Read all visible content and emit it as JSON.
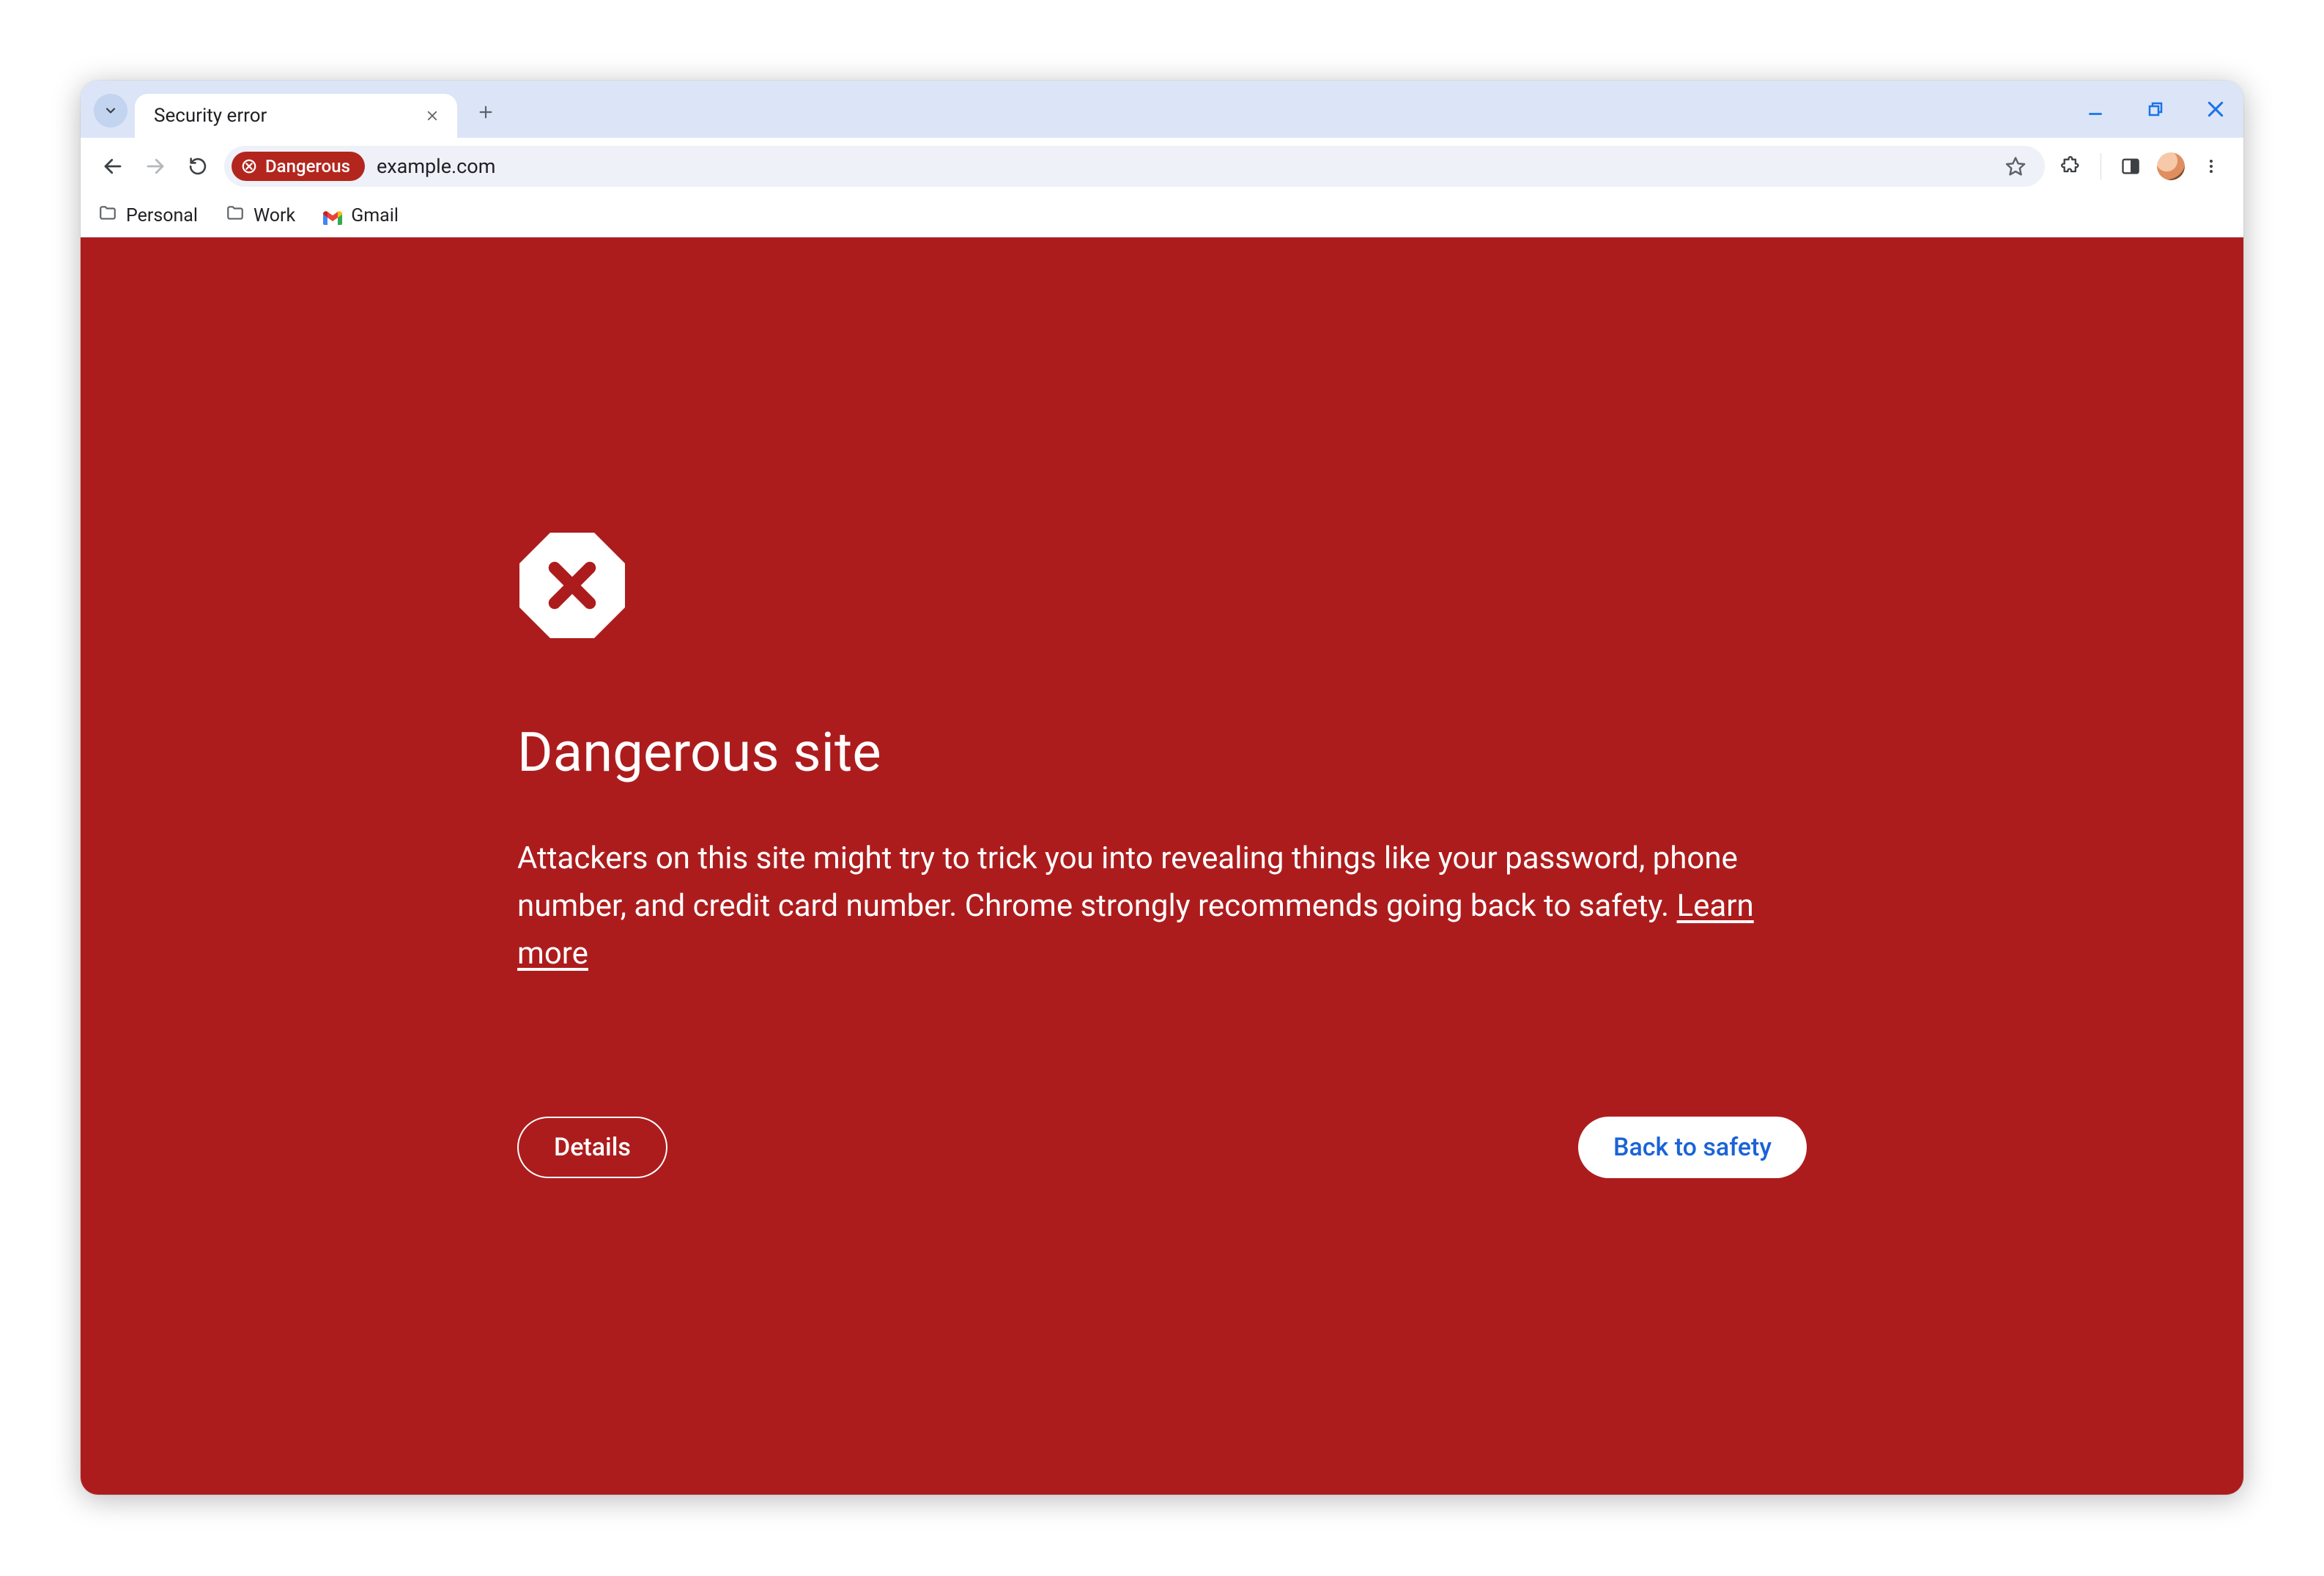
{
  "tab": {
    "title": "Security error"
  },
  "omnibox": {
    "chip_label": "Dangerous",
    "url": "example.com"
  },
  "bookmarks": [
    {
      "label": "Personal",
      "icon": "folder"
    },
    {
      "label": "Work",
      "icon": "folder"
    },
    {
      "label": "Gmail",
      "icon": "gmail"
    }
  ],
  "interstitial": {
    "heading": "Dangerous site",
    "body": "Attackers on this site might try to trick you into revealing things like your password, phone number, and credit card number. Chrome strongly recommends going back to safety. ",
    "learn_more": "Learn more",
    "details_btn": "Details",
    "safety_btn": "Back to safety"
  },
  "colors": {
    "danger_bg": "#ad1c1d",
    "danger_chip_bg": "#b3261e",
    "tabstrip_bg": "#dbe5f7",
    "win_control": "#1a73e8"
  }
}
